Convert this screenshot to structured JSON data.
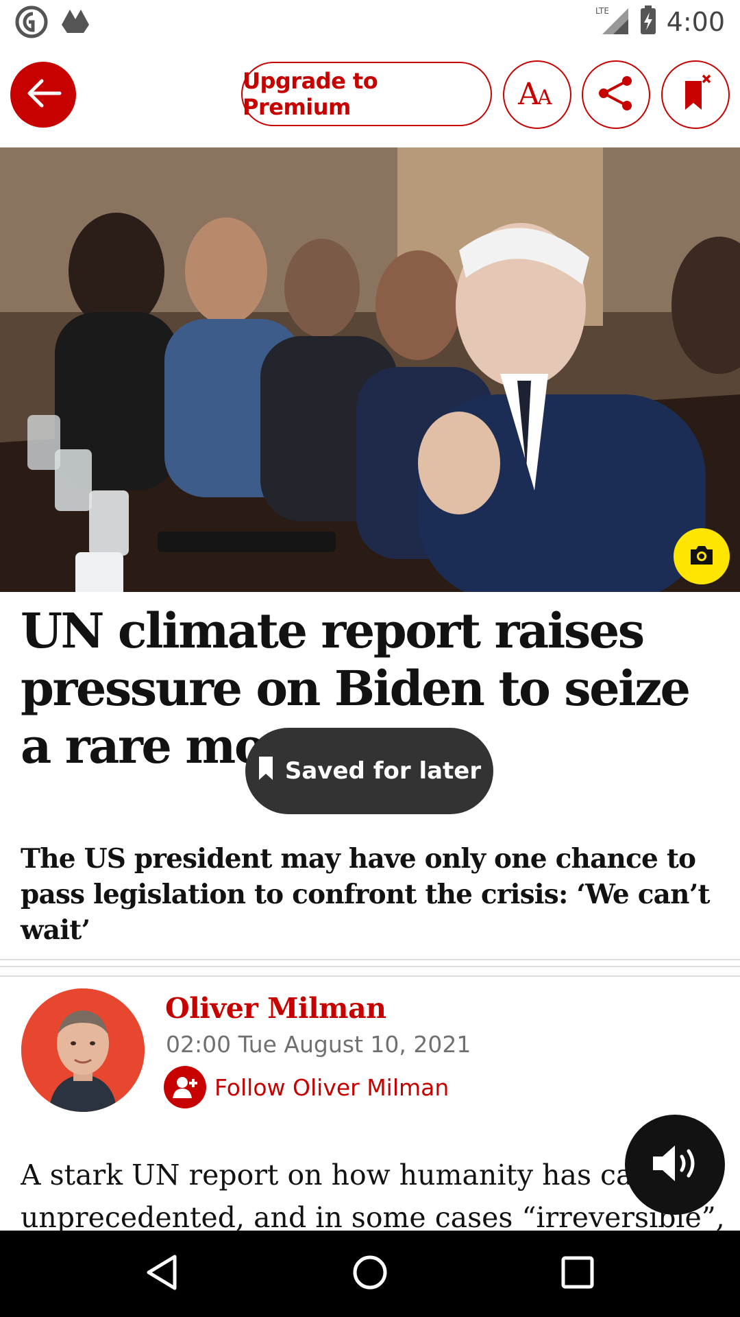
{
  "status_bar": {
    "time": "4:00",
    "network": "LTE",
    "icons": [
      "guardian-logo-icon",
      "drive-icon",
      "lte-signal-icon",
      "battery-charging-icon"
    ]
  },
  "toolbar": {
    "back_icon": "arrow-left-icon",
    "premium_label": "Upgrade to Premium",
    "text_size_label": "AA",
    "share_icon": "share-icon",
    "unsave_icon": "bookmark-remove-icon"
  },
  "hero": {
    "image": "photo of president at a cabinet table with officials",
    "camera_icon": "camera-icon"
  },
  "article": {
    "headline": "UN climate report raises pressure on Biden to seize a rare mome",
    "standfirst": "The US president may have only one chance to pass legislation to confront the crisis: ‘We can’t wait’",
    "body_line_1": "A stark UN report on how humanity has caus",
    "body_line_2": "unprecedented, and in some cases “irreversible”,"
  },
  "toast": {
    "label": "Saved for later",
    "icon": "bookmark-icon"
  },
  "byline": {
    "author": "Oliver Milman",
    "date": "02:00 Tue August 10, 2021",
    "follow_label": "Follow Oliver Milman",
    "follow_icon": "add-person-icon"
  },
  "audio": {
    "icon": "speaker-icon"
  },
  "nav_bar": {
    "icons": [
      "back-triangle-icon",
      "home-circle-icon",
      "recents-square-icon"
    ]
  },
  "colors": {
    "accent": "#c70000",
    "camera_badge": "#ffe500",
    "toast_bg": "#333333"
  }
}
